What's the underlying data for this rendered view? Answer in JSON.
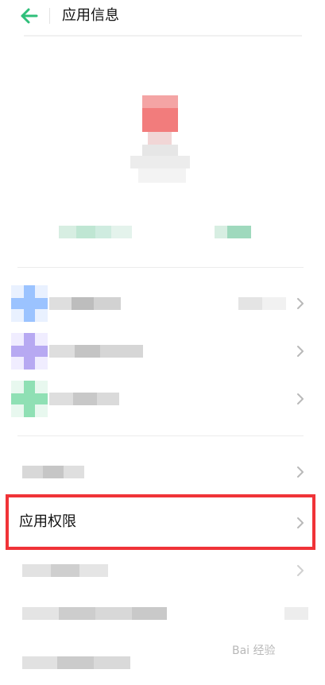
{
  "header": {
    "title": "应用信息",
    "back_icon": "arrow-left-icon",
    "accent_color": "#2fbf7a"
  },
  "permission_row": {
    "label": "应用权限",
    "highlight_color": "#f03338"
  },
  "watermark": {
    "text": "Bai 经验"
  }
}
